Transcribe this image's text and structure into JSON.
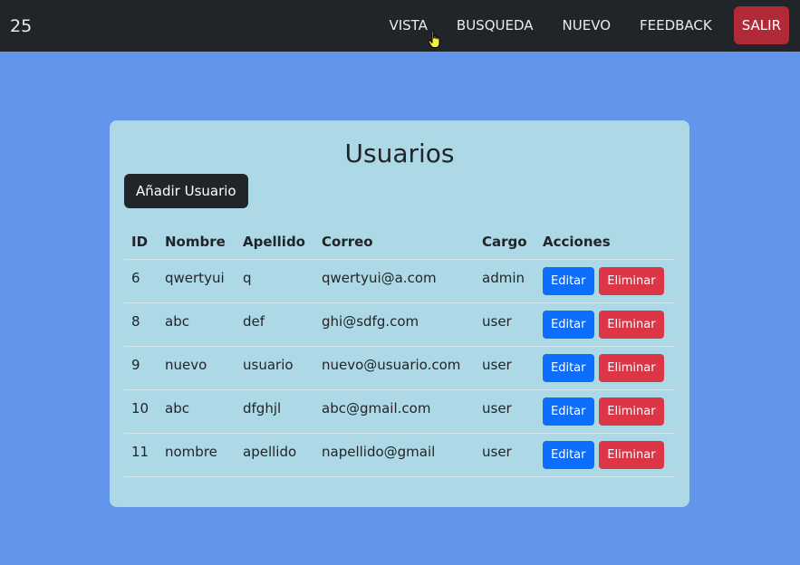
{
  "navbar": {
    "brand": "25",
    "links": [
      "VISTA",
      "BUSQUEDA",
      "NUEVO",
      "FEEDBACK"
    ],
    "logout": "SALIR"
  },
  "card": {
    "title": "Usuarios",
    "add_button": "Añadir Usuario",
    "table": {
      "headers": [
        "ID",
        "Nombre",
        "Apellido",
        "Correo",
        "Cargo",
        "Acciones"
      ],
      "rows": [
        {
          "id": "6",
          "nombre": "qwertyui",
          "apellido": "q",
          "correo": "qwertyui@a.com",
          "cargo": "admin"
        },
        {
          "id": "8",
          "nombre": "abc",
          "apellido": "def",
          "correo": "ghi@sdfg.com",
          "cargo": "user"
        },
        {
          "id": "9",
          "nombre": "nuevo",
          "apellido": "usuario",
          "correo": "nuevo@usuario.com",
          "cargo": "user"
        },
        {
          "id": "10",
          "nombre": "abc",
          "apellido": "dfghjl",
          "correo": "abc@gmail.com",
          "cargo": "user"
        },
        {
          "id": "11",
          "nombre": "nombre",
          "apellido": "apellido",
          "correo": "napellido@gmail",
          "cargo": "user"
        }
      ],
      "edit_label": "Editar",
      "delete_label": "Eliminar"
    }
  },
  "colors": {
    "background": "#6495ed",
    "navbar": "#212529",
    "card": "#add8e6",
    "edit": "#0d6efd",
    "delete": "#dc3545",
    "logout": "#b02a37"
  },
  "icons": {
    "cursor": "hand-pointer-icon"
  }
}
